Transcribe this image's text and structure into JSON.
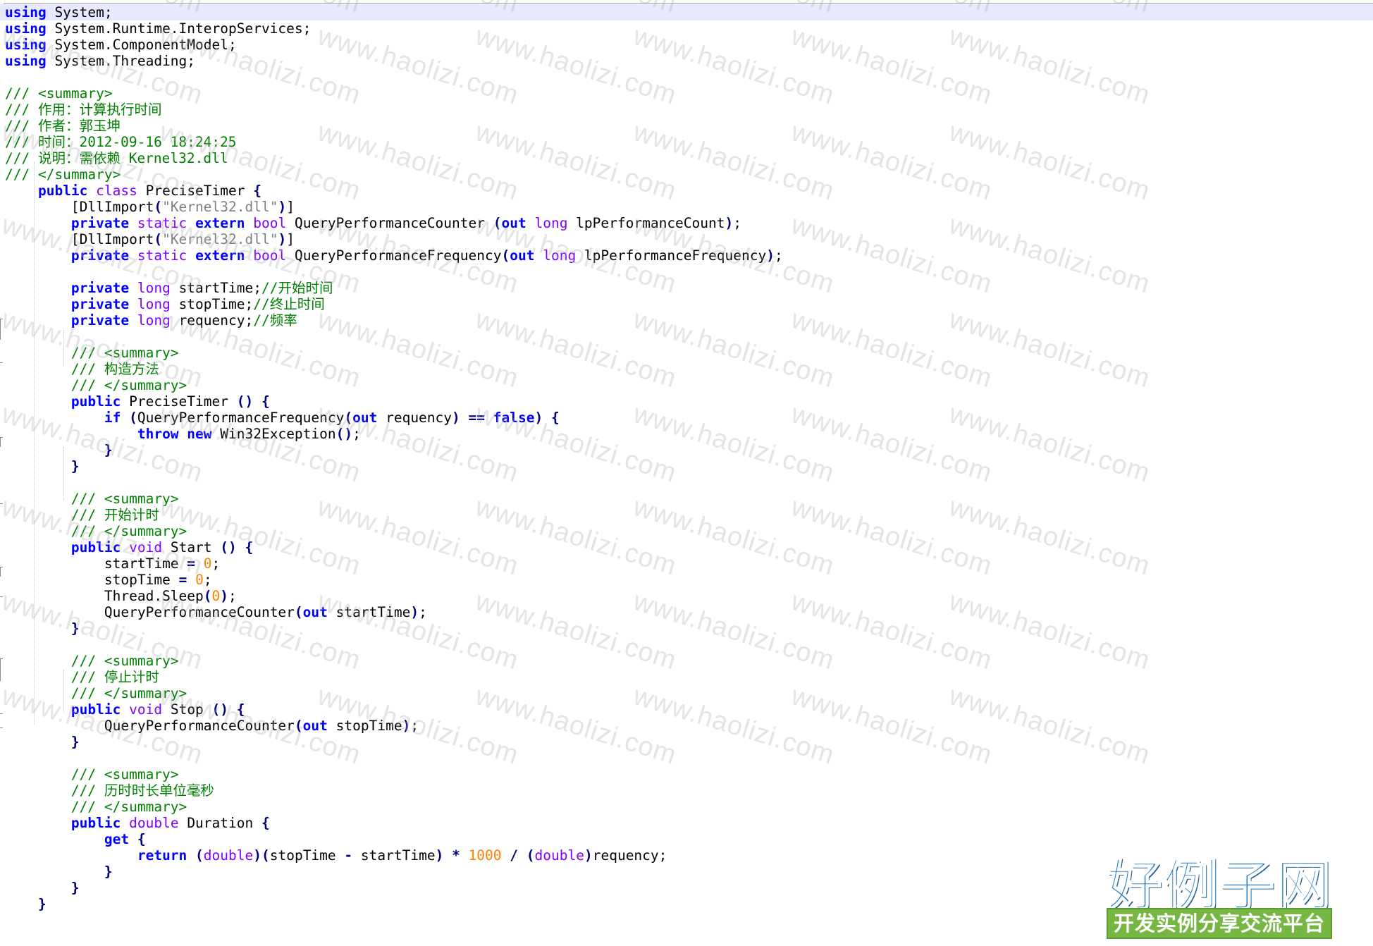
{
  "editor": {
    "colors": {
      "keyword": "#0000ff",
      "type": "#8000ff",
      "comment": "#008000",
      "string": "#808080",
      "number": "#ff8000",
      "operator": "#000080",
      "current_line": "#e8e8ff"
    },
    "lines": [
      [
        {
          "t": "kw",
          "v": "using"
        },
        {
          "t": "plain",
          "v": " System;"
        }
      ],
      [
        {
          "t": "kw",
          "v": "using"
        },
        {
          "t": "plain",
          "v": " System.Runtime.InteropServices;"
        }
      ],
      [
        {
          "t": "kw",
          "v": "using"
        },
        {
          "t": "plain",
          "v": " System.ComponentModel;"
        }
      ],
      [
        {
          "t": "kw",
          "v": "using"
        },
        {
          "t": "plain",
          "v": " System.Threading;"
        }
      ],
      [],
      [
        {
          "t": "cmt",
          "v": "/// <summary>"
        }
      ],
      [
        {
          "t": "cmt",
          "v": "/// 作用：计算执行时间"
        }
      ],
      [
        {
          "t": "cmt",
          "v": "/// 作者：郭玉坤"
        }
      ],
      [
        {
          "t": "cmt",
          "v": "/// 时间：2012-09-16 18:24:25"
        }
      ],
      [
        {
          "t": "cmt",
          "v": "/// 说明：需依赖 Kernel32.dll"
        }
      ],
      [
        {
          "t": "cmt",
          "v": "/// </summary>"
        }
      ],
      [
        {
          "t": "ws",
          "v": "    "
        },
        {
          "t": "kw",
          "v": "public"
        },
        {
          "t": "plain",
          "v": " "
        },
        {
          "t": "type",
          "v": "class"
        },
        {
          "t": "plain",
          "v": " PreciseTimer "
        },
        {
          "t": "op",
          "v": "{"
        }
      ],
      [
        {
          "t": "ws",
          "v": "        "
        },
        {
          "t": "plain",
          "v": "[DllImport"
        },
        {
          "t": "op",
          "v": "("
        },
        {
          "t": "str",
          "v": "\"Kernel32.dll\""
        },
        {
          "t": "op",
          "v": ")"
        },
        {
          "t": "plain",
          "v": "]"
        }
      ],
      [
        {
          "t": "ws",
          "v": "        "
        },
        {
          "t": "kw",
          "v": "private"
        },
        {
          "t": "plain",
          "v": " "
        },
        {
          "t": "type",
          "v": "static"
        },
        {
          "t": "plain",
          "v": " "
        },
        {
          "t": "kw",
          "v": "extern"
        },
        {
          "t": "plain",
          "v": " "
        },
        {
          "t": "type",
          "v": "bool"
        },
        {
          "t": "plain",
          "v": " QueryPerformanceCounter "
        },
        {
          "t": "op",
          "v": "("
        },
        {
          "t": "kw",
          "v": "out"
        },
        {
          "t": "plain",
          "v": " "
        },
        {
          "t": "type",
          "v": "long"
        },
        {
          "t": "plain",
          "v": " lpPerformanceCount"
        },
        {
          "t": "op",
          "v": ")"
        },
        {
          "t": "plain",
          "v": ";"
        }
      ],
      [
        {
          "t": "ws",
          "v": "        "
        },
        {
          "t": "plain",
          "v": "[DllImport"
        },
        {
          "t": "op",
          "v": "("
        },
        {
          "t": "str",
          "v": "\"Kernel32.dll\""
        },
        {
          "t": "op",
          "v": ")"
        },
        {
          "t": "plain",
          "v": "]"
        }
      ],
      [
        {
          "t": "ws",
          "v": "        "
        },
        {
          "t": "kw",
          "v": "private"
        },
        {
          "t": "plain",
          "v": " "
        },
        {
          "t": "type",
          "v": "static"
        },
        {
          "t": "plain",
          "v": " "
        },
        {
          "t": "kw",
          "v": "extern"
        },
        {
          "t": "plain",
          "v": " "
        },
        {
          "t": "type",
          "v": "bool"
        },
        {
          "t": "plain",
          "v": " QueryPerformanceFrequency"
        },
        {
          "t": "op",
          "v": "("
        },
        {
          "t": "kw",
          "v": "out"
        },
        {
          "t": "plain",
          "v": " "
        },
        {
          "t": "type",
          "v": "long"
        },
        {
          "t": "plain",
          "v": " lpPerformanceFrequency"
        },
        {
          "t": "op",
          "v": ")"
        },
        {
          "t": "plain",
          "v": ";"
        }
      ],
      [],
      [
        {
          "t": "ws",
          "v": "        "
        },
        {
          "t": "kw",
          "v": "private"
        },
        {
          "t": "plain",
          "v": " "
        },
        {
          "t": "type",
          "v": "long"
        },
        {
          "t": "plain",
          "v": " startTime;"
        },
        {
          "t": "cmt",
          "v": "//开始时间"
        }
      ],
      [
        {
          "t": "ws",
          "v": "        "
        },
        {
          "t": "kw",
          "v": "private"
        },
        {
          "t": "plain",
          "v": " "
        },
        {
          "t": "type",
          "v": "long"
        },
        {
          "t": "plain",
          "v": " stopTime;"
        },
        {
          "t": "cmt",
          "v": "//终止时间"
        }
      ],
      [
        {
          "t": "ws",
          "v": "        "
        },
        {
          "t": "kw",
          "v": "private"
        },
        {
          "t": "plain",
          "v": " "
        },
        {
          "t": "type",
          "v": "long"
        },
        {
          "t": "plain",
          "v": " requency;"
        },
        {
          "t": "cmt",
          "v": "//频率"
        }
      ],
      [],
      [
        {
          "t": "ws",
          "v": "        "
        },
        {
          "t": "cmt",
          "v": "/// <summary>"
        }
      ],
      [
        {
          "t": "ws",
          "v": "        "
        },
        {
          "t": "cmt",
          "v": "/// 构造方法"
        }
      ],
      [
        {
          "t": "ws",
          "v": "        "
        },
        {
          "t": "cmt",
          "v": "/// </summary>"
        }
      ],
      [
        {
          "t": "ws",
          "v": "        "
        },
        {
          "t": "kw",
          "v": "public"
        },
        {
          "t": "plain",
          "v": " PreciseTimer "
        },
        {
          "t": "op",
          "v": "()"
        },
        {
          "t": "plain",
          "v": " "
        },
        {
          "t": "op",
          "v": "{"
        }
      ],
      [
        {
          "t": "ws",
          "v": "            "
        },
        {
          "t": "kw",
          "v": "if"
        },
        {
          "t": "plain",
          "v": " "
        },
        {
          "t": "op",
          "v": "("
        },
        {
          "t": "plain",
          "v": "QueryPerformanceFrequency"
        },
        {
          "t": "op",
          "v": "("
        },
        {
          "t": "kw",
          "v": "out"
        },
        {
          "t": "plain",
          "v": " requency"
        },
        {
          "t": "op",
          "v": ")"
        },
        {
          "t": "plain",
          "v": " "
        },
        {
          "t": "op",
          "v": "=="
        },
        {
          "t": "plain",
          "v": " "
        },
        {
          "t": "kw",
          "v": "false"
        },
        {
          "t": "op",
          "v": ")"
        },
        {
          "t": "plain",
          "v": " "
        },
        {
          "t": "op",
          "v": "{"
        }
      ],
      [
        {
          "t": "ws",
          "v": "                "
        },
        {
          "t": "kw",
          "v": "throw"
        },
        {
          "t": "plain",
          "v": " "
        },
        {
          "t": "kw",
          "v": "new"
        },
        {
          "t": "plain",
          "v": " Win32Exception"
        },
        {
          "t": "op",
          "v": "()"
        },
        {
          "t": "plain",
          "v": ";"
        }
      ],
      [
        {
          "t": "ws",
          "v": "            "
        },
        {
          "t": "op",
          "v": "}"
        }
      ],
      [
        {
          "t": "ws",
          "v": "        "
        },
        {
          "t": "op",
          "v": "}"
        }
      ],
      [],
      [
        {
          "t": "ws",
          "v": "        "
        },
        {
          "t": "cmt",
          "v": "/// <summary>"
        }
      ],
      [
        {
          "t": "ws",
          "v": "        "
        },
        {
          "t": "cmt",
          "v": "/// 开始计时"
        }
      ],
      [
        {
          "t": "ws",
          "v": "        "
        },
        {
          "t": "cmt",
          "v": "/// </summary>"
        }
      ],
      [
        {
          "t": "ws",
          "v": "        "
        },
        {
          "t": "kw",
          "v": "public"
        },
        {
          "t": "plain",
          "v": " "
        },
        {
          "t": "type",
          "v": "void"
        },
        {
          "t": "plain",
          "v": " Start "
        },
        {
          "t": "op",
          "v": "()"
        },
        {
          "t": "plain",
          "v": " "
        },
        {
          "t": "op",
          "v": "{"
        }
      ],
      [
        {
          "t": "ws",
          "v": "            "
        },
        {
          "t": "plain",
          "v": "startTime "
        },
        {
          "t": "op",
          "v": "="
        },
        {
          "t": "plain",
          "v": " "
        },
        {
          "t": "num",
          "v": "0"
        },
        {
          "t": "plain",
          "v": ";"
        }
      ],
      [
        {
          "t": "ws",
          "v": "            "
        },
        {
          "t": "plain",
          "v": "stopTime "
        },
        {
          "t": "op",
          "v": "="
        },
        {
          "t": "plain",
          "v": " "
        },
        {
          "t": "num",
          "v": "0"
        },
        {
          "t": "plain",
          "v": ";"
        }
      ],
      [
        {
          "t": "ws",
          "v": "            "
        },
        {
          "t": "plain",
          "v": "Thread.Sleep"
        },
        {
          "t": "op",
          "v": "("
        },
        {
          "t": "num",
          "v": "0"
        },
        {
          "t": "op",
          "v": ")"
        },
        {
          "t": "plain",
          "v": ";"
        }
      ],
      [
        {
          "t": "ws",
          "v": "            "
        },
        {
          "t": "plain",
          "v": "QueryPerformanceCounter"
        },
        {
          "t": "op",
          "v": "("
        },
        {
          "t": "kw",
          "v": "out"
        },
        {
          "t": "plain",
          "v": " startTime"
        },
        {
          "t": "op",
          "v": ")"
        },
        {
          "t": "plain",
          "v": ";"
        }
      ],
      [
        {
          "t": "ws",
          "v": "        "
        },
        {
          "t": "op",
          "v": "}"
        }
      ],
      [],
      [
        {
          "t": "ws",
          "v": "        "
        },
        {
          "t": "cmt",
          "v": "/// <summary>"
        }
      ],
      [
        {
          "t": "ws",
          "v": "        "
        },
        {
          "t": "cmt",
          "v": "/// 停止计时"
        }
      ],
      [
        {
          "t": "ws",
          "v": "        "
        },
        {
          "t": "cmt",
          "v": "/// </summary>"
        }
      ],
      [
        {
          "t": "ws",
          "v": "        "
        },
        {
          "t": "kw",
          "v": "public"
        },
        {
          "t": "plain",
          "v": " "
        },
        {
          "t": "type",
          "v": "void"
        },
        {
          "t": "plain",
          "v": " Stop "
        },
        {
          "t": "op",
          "v": "()"
        },
        {
          "t": "plain",
          "v": " "
        },
        {
          "t": "op",
          "v": "{"
        }
      ],
      [
        {
          "t": "ws",
          "v": "            "
        },
        {
          "t": "plain",
          "v": "QueryPerformanceCounter"
        },
        {
          "t": "op",
          "v": "("
        },
        {
          "t": "kw",
          "v": "out"
        },
        {
          "t": "plain",
          "v": " stopTime"
        },
        {
          "t": "op",
          "v": ")"
        },
        {
          "t": "plain",
          "v": ";"
        }
      ],
      [
        {
          "t": "ws",
          "v": "        "
        },
        {
          "t": "op",
          "v": "}"
        }
      ],
      [],
      [
        {
          "t": "ws",
          "v": "        "
        },
        {
          "t": "cmt",
          "v": "/// <summary>"
        }
      ],
      [
        {
          "t": "ws",
          "v": "        "
        },
        {
          "t": "cmt",
          "v": "/// 历时时长单位毫秒"
        }
      ],
      [
        {
          "t": "ws",
          "v": "        "
        },
        {
          "t": "cmt",
          "v": "/// </summary>"
        }
      ],
      [
        {
          "t": "ws",
          "v": "        "
        },
        {
          "t": "kw",
          "v": "public"
        },
        {
          "t": "plain",
          "v": " "
        },
        {
          "t": "type",
          "v": "double"
        },
        {
          "t": "plain",
          "v": " Duration "
        },
        {
          "t": "op",
          "v": "{"
        }
      ],
      [
        {
          "t": "ws",
          "v": "            "
        },
        {
          "t": "kw",
          "v": "get"
        },
        {
          "t": "plain",
          "v": " "
        },
        {
          "t": "op",
          "v": "{"
        }
      ],
      [
        {
          "t": "ws",
          "v": "                "
        },
        {
          "t": "kw",
          "v": "return"
        },
        {
          "t": "plain",
          "v": " "
        },
        {
          "t": "op",
          "v": "("
        },
        {
          "t": "type",
          "v": "double"
        },
        {
          "t": "op",
          "v": ")("
        },
        {
          "t": "plain",
          "v": "stopTime "
        },
        {
          "t": "op",
          "v": "-"
        },
        {
          "t": "plain",
          "v": " startTime"
        },
        {
          "t": "op",
          "v": ")"
        },
        {
          "t": "plain",
          "v": " "
        },
        {
          "t": "op",
          "v": "*"
        },
        {
          "t": "plain",
          "v": " "
        },
        {
          "t": "num",
          "v": "1000"
        },
        {
          "t": "plain",
          "v": " "
        },
        {
          "t": "op",
          "v": "/"
        },
        {
          "t": "plain",
          "v": " "
        },
        {
          "t": "op",
          "v": "("
        },
        {
          "t": "type",
          "v": "double"
        },
        {
          "t": "op",
          "v": ")"
        },
        {
          "t": "plain",
          "v": "requency;"
        }
      ],
      [
        {
          "t": "ws",
          "v": "            "
        },
        {
          "t": "op",
          "v": "}"
        }
      ],
      [
        {
          "t": "ws",
          "v": "        "
        },
        {
          "t": "op",
          "v": "}"
        }
      ],
      [
        {
          "t": "ws",
          "v": "    "
        },
        {
          "t": "op",
          "v": "}"
        }
      ]
    ]
  },
  "watermark": {
    "text": "www.haolizi.com"
  },
  "brand": {
    "title": "好例子网",
    "subtitle": "开发实例分享交流平台",
    "title_color": "#2a80c6",
    "bar_color": "#76b743"
  }
}
